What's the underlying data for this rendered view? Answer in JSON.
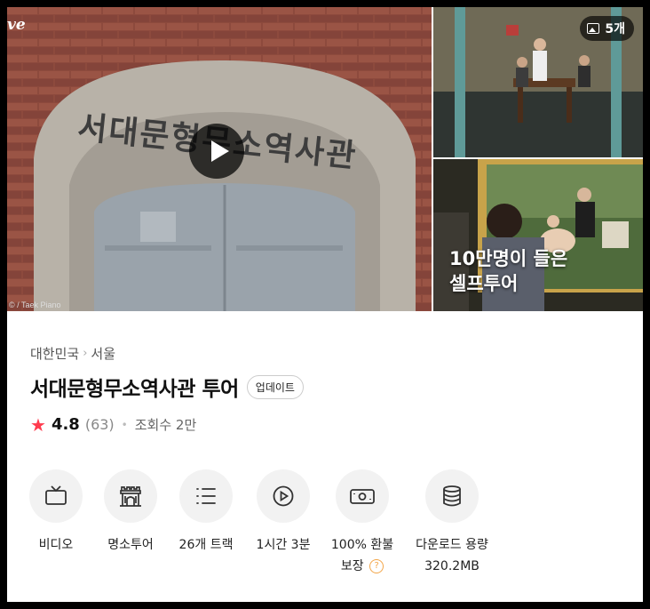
{
  "gallery": {
    "brand_mark": "ve",
    "main_credit": "© / Taek Piano",
    "photo_count": "5개",
    "promo_line1": "10만명이 들은",
    "promo_line2": "셀프투어",
    "sign_text": "서대문형무소역사관"
  },
  "breadcrumb": [
    "대한민국",
    "서울"
  ],
  "breadcrumb_separator": "›",
  "title": "서대문형무소역사관 투어",
  "badge": "업데이트",
  "rating": {
    "score": "4.8",
    "count": "(63)",
    "views": "조회수 2만",
    "star_color": "#ff3b4e"
  },
  "features": [
    {
      "icon": "tv-icon",
      "label": "비디오"
    },
    {
      "icon": "landmark-icon",
      "label": "명소투어"
    },
    {
      "icon": "list-icon",
      "label": "26개 트랙"
    },
    {
      "icon": "play-circle-icon",
      "label": "1시간 3분"
    },
    {
      "icon": "money-icon",
      "label": "100% 환불",
      "label2": "보장"
    },
    {
      "icon": "database-icon",
      "label": "다운로드 용량",
      "label2": "320.2MB"
    }
  ],
  "help_mark": "?"
}
